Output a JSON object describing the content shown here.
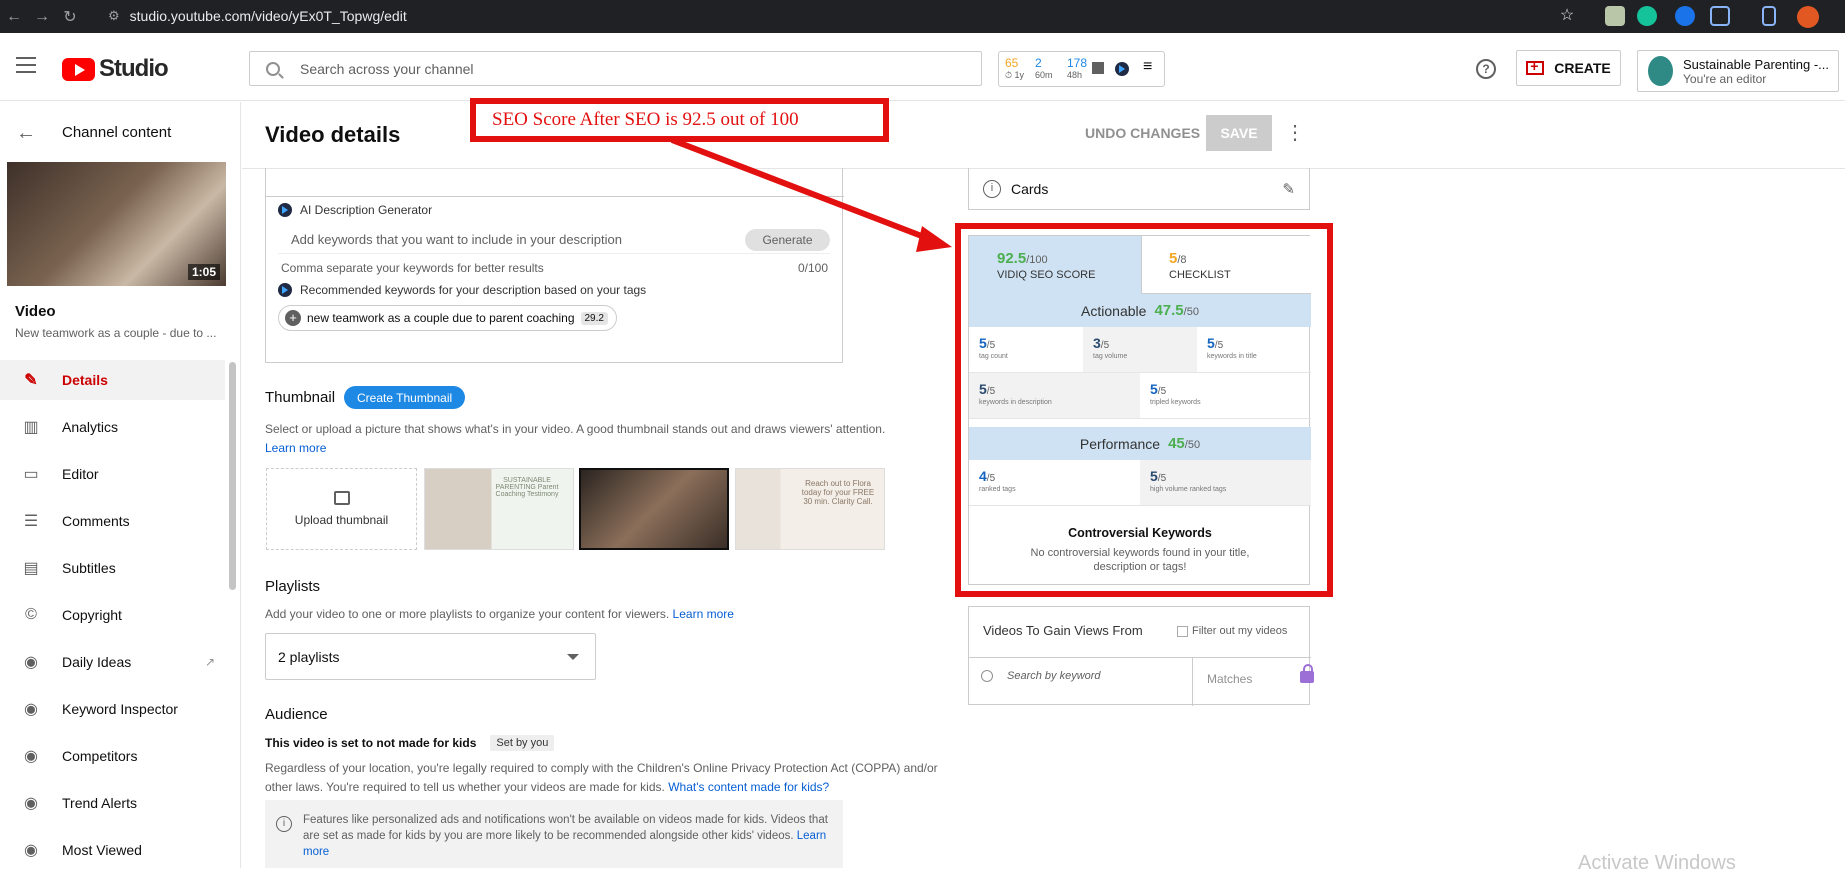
{
  "browser": {
    "url": "studio.youtube.com/video/yEx0T_Topwg/edit"
  },
  "header": {
    "logo_text": "Studio",
    "search_placeholder": "Search across your channel",
    "vidiq": [
      {
        "value": "65",
        "sub": "⏱ 1y",
        "color": "#f5a623"
      },
      {
        "value": "2",
        "sub": "60m",
        "color": "#1e88e5"
      },
      {
        "value": "178",
        "sub": "48h",
        "color": "#1e88e5"
      }
    ],
    "help_icon": "?",
    "create_label": "CREATE",
    "account_name": "Sustainable Parenting -...",
    "account_role": "You're an editor"
  },
  "sidebar": {
    "back_label": "Channel content",
    "video_duration": "1:05",
    "video_label": "Video",
    "video_title": "New teamwork as a couple - due to ...",
    "items": [
      {
        "label": "Details",
        "icon": "✎"
      },
      {
        "label": "Analytics",
        "icon": "▥"
      },
      {
        "label": "Editor",
        "icon": "▭"
      },
      {
        "label": "Comments",
        "icon": "☰"
      },
      {
        "label": "Subtitles",
        "icon": "▤"
      },
      {
        "label": "Copyright",
        "icon": "©"
      },
      {
        "label": "Daily Ideas",
        "icon": "◉"
      },
      {
        "label": "Keyword Inspector",
        "icon": "◉"
      },
      {
        "label": "Competitors",
        "icon": "◉"
      },
      {
        "label": "Trend Alerts",
        "icon": "◉"
      },
      {
        "label": "Most Viewed",
        "icon": "◉"
      }
    ],
    "external_icon": "↗"
  },
  "main": {
    "title": "Video details",
    "undo_label": "UNDO CHANGES",
    "save_label": "SAVE",
    "more_icon": "⋮",
    "ai": {
      "title": "AI Description Generator",
      "placeholder": "Add keywords that you want to include in your description",
      "generate_label": "Generate",
      "help": "Comma separate your keywords for better results",
      "counter": "0/100",
      "recommended": "Recommended keywords for your description based on your tags",
      "chip_label": "new teamwork as a couple due to parent coaching",
      "chip_score": "29.2"
    },
    "thumbnail": {
      "title": "Thumbnail",
      "create_label": "Create Thumbnail",
      "desc": "Select or upload a picture that shows what's in your video. A good thumbnail stands out and draws viewers' attention.",
      "learn_more": "Learn more",
      "upload_label": "Upload thumbnail",
      "thumb3_caption": "Reach out to Flora today for your FREE 30 min. Clarity Call.",
      "thumb1_caption": "SUSTAINABLE PARENTING Parent Coaching Testimony"
    },
    "playlists": {
      "title": "Playlists",
      "desc": "Add your video to one or more playlists to organize your content for viewers.",
      "learn_more": "Learn more",
      "selected": "2 playlists"
    },
    "audience": {
      "title": "Audience",
      "status": "This video is set to not made for kids",
      "set_by": "Set by you",
      "desc": "Regardless of your location, you're legally required to comply with the Children's Online Privacy Protection Act (COPPA) and/or other laws. You're required to tell us whether your videos are made for kids.",
      "link": "What's content made for kids?",
      "info": "Features like personalized ads and notifications won't be available on videos made for kids. Videos that are set as made for kids by you are more likely to be recommended alongside other kids' videos.",
      "info_link": "Learn more"
    }
  },
  "right": {
    "cards_label": "Cards",
    "seo": {
      "score": "92.5",
      "score_den": "/100",
      "score_label": "VIDIQ SEO SCORE",
      "score_color": "#4caf50",
      "checklist": "5",
      "checklist_den": "/8",
      "checklist_label": "CHECKLIST",
      "checklist_color": "#f5a623",
      "actionable_label": "Actionable",
      "actionable_value": "47.5",
      "actionable_den": "/50",
      "actionable_cells": [
        {
          "v": "5",
          "d": "/5",
          "l": "tag count"
        },
        {
          "v": "3",
          "d": "/5",
          "l": "tag volume"
        },
        {
          "v": "5",
          "d": "/5",
          "l": "keywords in title"
        },
        {
          "v": "5",
          "d": "/5",
          "l": "keywords in description"
        },
        {
          "v": "5",
          "d": "/5",
          "l": "tripled keywords"
        }
      ],
      "performance_label": "Performance",
      "performance_value": "45",
      "performance_den": "/50",
      "performance_cells": [
        {
          "v": "4",
          "d": "/5",
          "l": "ranked tags"
        },
        {
          "v": "5",
          "d": "/5",
          "l": "high volume ranked tags"
        }
      ],
      "controversial_title": "Controversial Keywords",
      "controversial_desc": "No controversial keywords found in your title, description or tags!"
    },
    "gain": {
      "title": "Videos To Gain Views From",
      "filter_label": "Filter out my videos",
      "search_placeholder": "Search by keyword",
      "matches_label": "Matches"
    }
  },
  "annotation": {
    "callout": "SEO Score After SEO is 92.5 out of 100",
    "color": "#e31010"
  },
  "watermark": "Activate Windows"
}
